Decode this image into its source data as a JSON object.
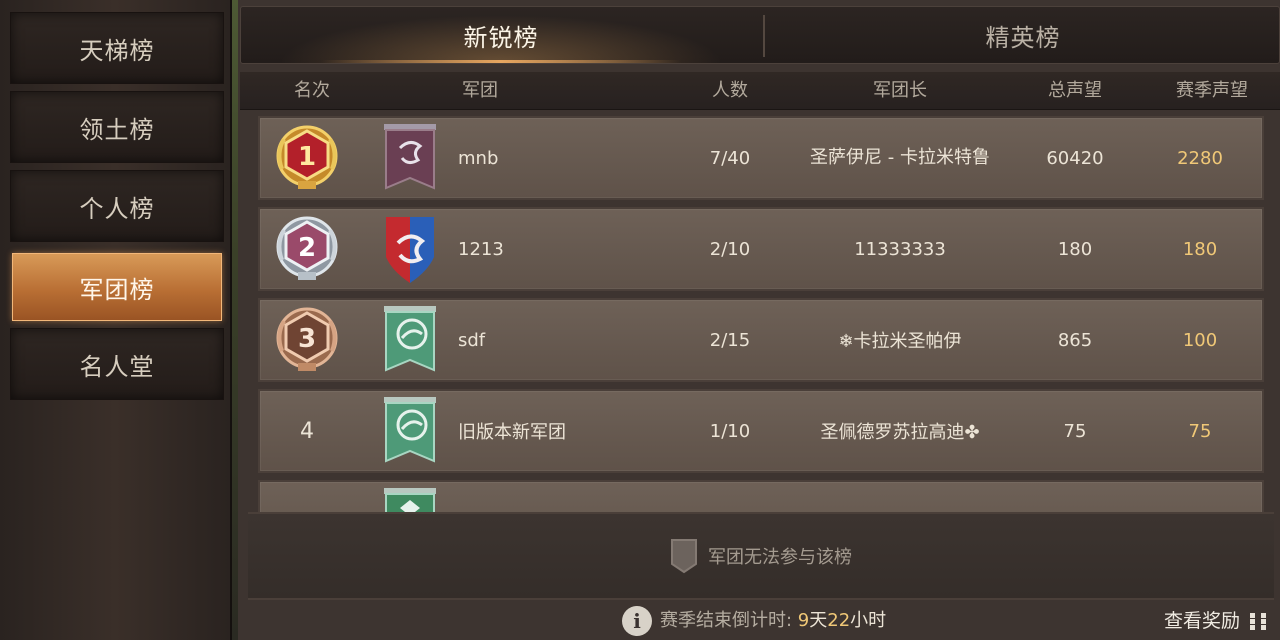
{
  "sidebar": {
    "items": [
      {
        "label": "天梯榜",
        "active": false
      },
      {
        "label": "领土榜",
        "active": false
      },
      {
        "label": "个人榜",
        "active": false
      },
      {
        "label": "军团榜",
        "active": true
      },
      {
        "label": "名人堂",
        "active": false
      }
    ]
  },
  "tabs": [
    {
      "label": "新锐榜",
      "active": true
    },
    {
      "label": "精英榜",
      "active": false
    }
  ],
  "columns": {
    "rank": "名次",
    "legion": "军团",
    "members": "人数",
    "leader": "军团长",
    "total": "总声望",
    "season": "赛季声望"
  },
  "rows": [
    {
      "rank": "1",
      "rank_style": "gold-medal",
      "flag": "purple-dragon-banner",
      "name": "mnb",
      "members": "7/40",
      "leader": "圣萨伊尼 - 卡拉米特鲁",
      "total": "60420",
      "season": "2280"
    },
    {
      "rank": "2",
      "rank_style": "silver-medal",
      "flag": "red-blue-dragon-shield",
      "name": "1213",
      "members": "2/10",
      "leader": "11333333",
      "total": "180",
      "season": "180"
    },
    {
      "rank": "3",
      "rank_style": "bronze-medal",
      "flag": "green-boar-banner",
      "name": "sdf",
      "members": "2/15",
      "leader": "❄卡拉米圣帕伊",
      "total": "865",
      "season": "100"
    },
    {
      "rank": "4",
      "rank_style": "plain",
      "flag": "green-boar-banner",
      "name": "旧版本新军团",
      "members": "1/10",
      "leader": "圣佩德罗苏拉高迪✤",
      "total": "75",
      "season": "75"
    }
  ],
  "notice": {
    "text": "军团无法参与该榜"
  },
  "footer": {
    "countdown_label": "赛季结束倒计时: ",
    "days_num": "9",
    "days_unit": "天",
    "hours_num": "22",
    "hours_unit": "小时",
    "reward_label": "查看奖励"
  },
  "colors": {
    "accent_active": "#c98244",
    "season_value": "#f0c877",
    "row_bg": "#66594f"
  },
  "icons": {
    "info": "info-icon",
    "reward": "grid-icon",
    "notice": "shield-icon"
  }
}
